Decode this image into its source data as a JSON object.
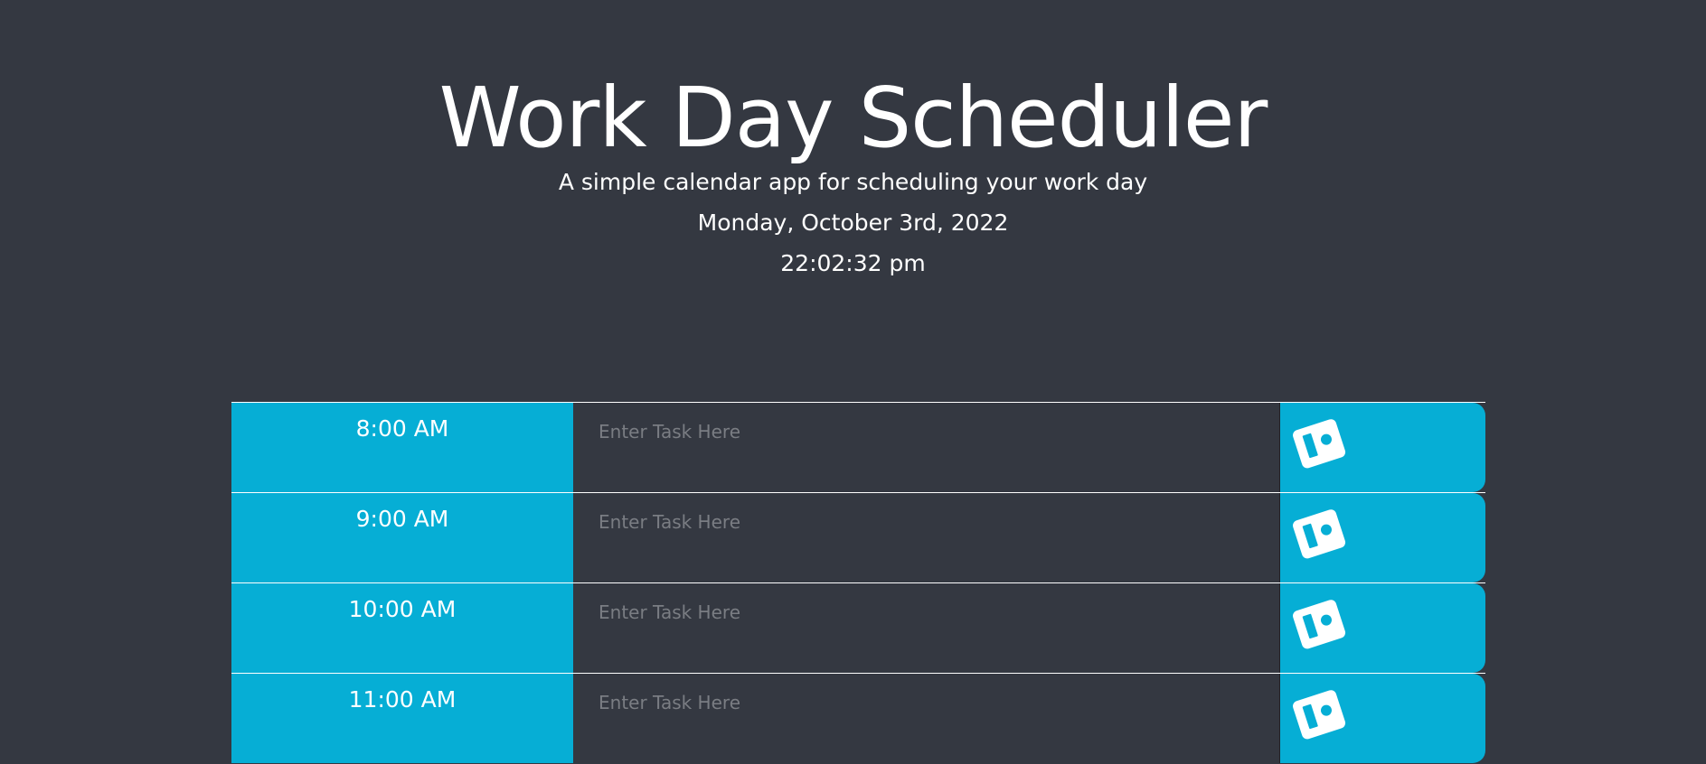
{
  "header": {
    "title": "Work Day Scheduler",
    "subtitle": "A simple calendar app for scheduling your work day",
    "date": "Monday, October 3rd, 2022",
    "time": "22:02:32 pm"
  },
  "colors": {
    "background": "#343841",
    "accent": "#06aed5",
    "text": "#ffffff"
  },
  "schedule": {
    "rows": [
      {
        "hour": "8:00 AM",
        "task_placeholder": "Enter Task Here",
        "save_icon": "save-icon"
      },
      {
        "hour": "9:00 AM",
        "task_placeholder": "Enter Task Here",
        "save_icon": "save-icon"
      },
      {
        "hour": "10:00 AM",
        "task_placeholder": "Enter Task Here",
        "save_icon": "save-icon"
      },
      {
        "hour": "11:00 AM",
        "task_placeholder": "Enter Task Here",
        "save_icon": "save-icon"
      }
    ]
  }
}
